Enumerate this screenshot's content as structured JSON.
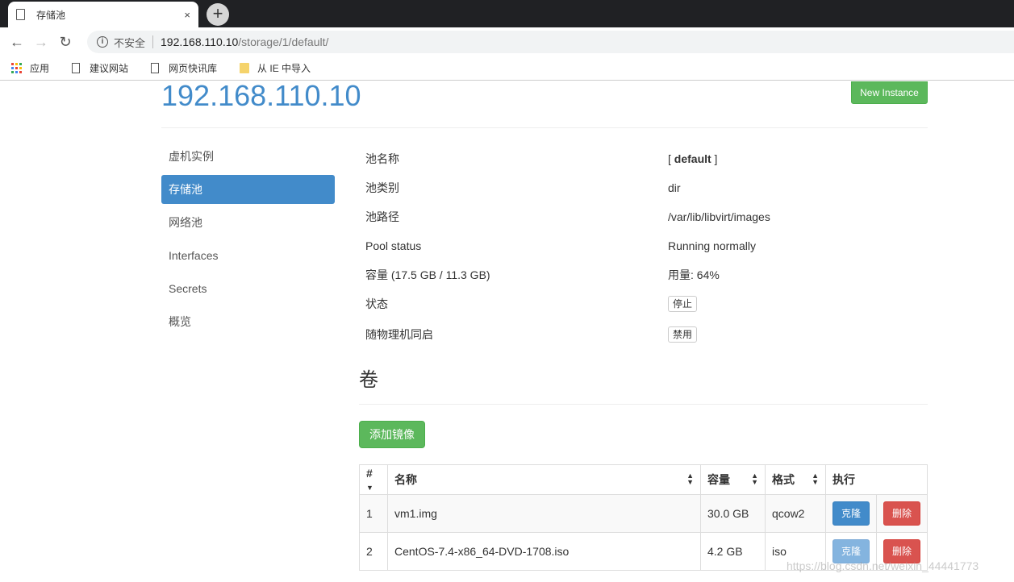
{
  "browser": {
    "tab_title": "存储池",
    "tab_close": "×",
    "new_tab": "+",
    "security_label": "不安全",
    "url_host": "192.168.110.10",
    "url_path": "/storage/1/default/",
    "bookmarks": [
      {
        "label": "应用",
        "icon": "apps-icon"
      },
      {
        "label": "建议网站",
        "icon": "page-icon"
      },
      {
        "label": "网页快讯库",
        "icon": "page-icon"
      },
      {
        "label": "从 IE 中导入",
        "icon": "folder-icon"
      }
    ]
  },
  "header": {
    "host": "192.168.110.10",
    "new_instance": "New Instance"
  },
  "sidebar": {
    "items": [
      {
        "label": "虚机实例"
      },
      {
        "label": "存储池",
        "active": true
      },
      {
        "label": "网络池"
      },
      {
        "label": "Interfaces"
      },
      {
        "label": "Secrets"
      },
      {
        "label": "概览"
      }
    ]
  },
  "pool": {
    "name_label": "池名称",
    "name_value": "default",
    "type_label": "池类别",
    "type_value": "dir",
    "path_label": "池路径",
    "path_value": "/var/lib/libvirt/images",
    "status_label": "Pool status",
    "status_value": "Running normally",
    "capacity_label": "容量 (17.5 GB / 11.3 GB)",
    "usage_value": "用量: 64%",
    "state_label": "状态",
    "state_button": "停止",
    "autostart_label": "随物理机同启",
    "autostart_button": "禁用"
  },
  "volumes": {
    "title": "卷",
    "add_button": "添加镜像",
    "columns": [
      "#",
      "名称",
      "容量",
      "格式",
      "执行"
    ],
    "rows": [
      {
        "num": "1",
        "name": "vm1.img",
        "size": "30.0 GB",
        "format": "qcow2",
        "clone": "克隆",
        "delete": "删除"
      },
      {
        "num": "2",
        "name": "CentOS-7.4-x86_64-DVD-1708.iso",
        "size": "4.2 GB",
        "format": "iso",
        "clone": "克隆",
        "delete": "删除"
      }
    ]
  },
  "watermark": "https://blog.csdn.net/weixin_44441773",
  "colors": {
    "primary": "#428bca",
    "success": "#5cb85c",
    "danger": "#d9534f"
  }
}
